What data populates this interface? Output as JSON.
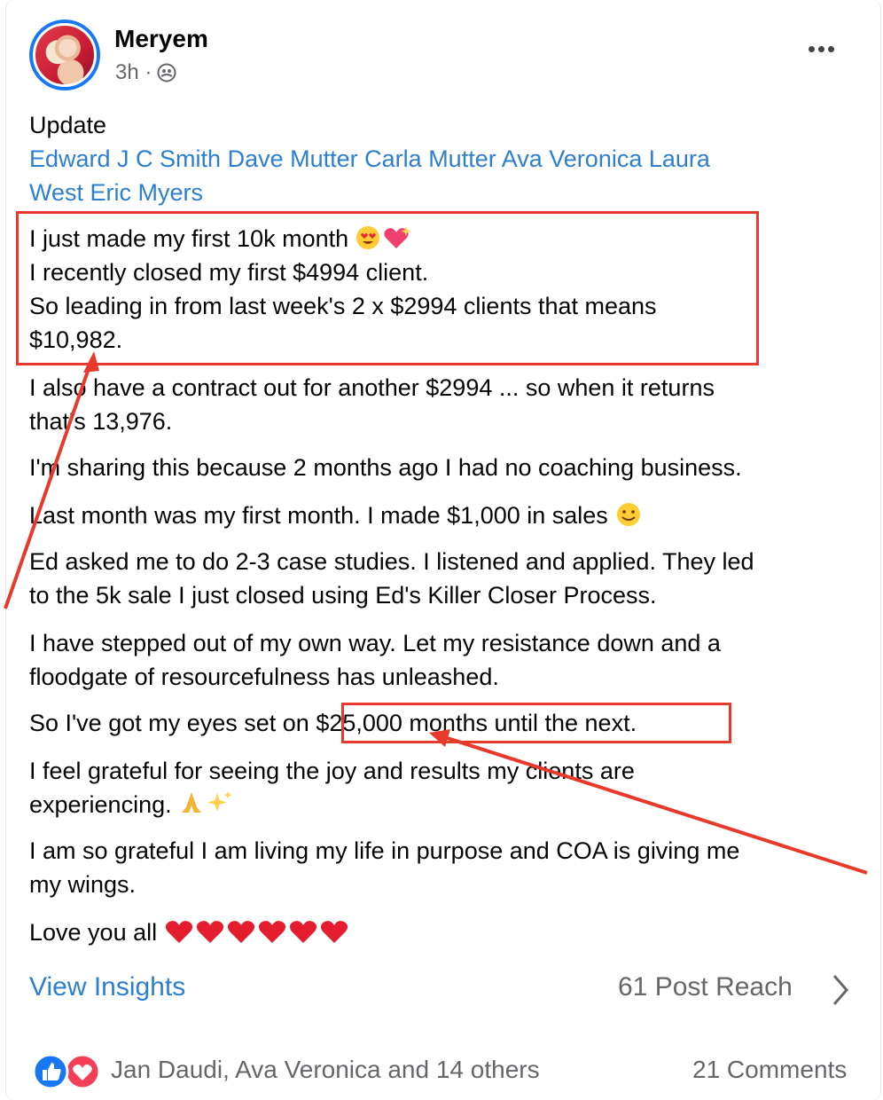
{
  "post": {
    "author": "Meryem",
    "time": "3h ·",
    "privacy_icon": "friends-icon",
    "title": "Update",
    "tags": [
      "Edward J C Smith",
      "Dave Mutter",
      "Carla Mutter",
      "Ava Veronica",
      "Laura",
      "West",
      "Eric Myers"
    ],
    "body": {
      "p1_l1": "I just made my first 10k month",
      "p1_l2": "I recently closed my first $4994 client.",
      "p1_l3": "So leading in from last week's 2  x $2994 clients that means",
      "p1_l4": "$10,982.",
      "p2_l1": "I also have a contract out for another $2994 ... so when it returns",
      "p2_l2": "that's 13,976.",
      "p3": "I'm sharing this because 2 months ago I had no coaching business.",
      "p4": "Last month was my first month. I made $1,000 in sales",
      "p5_l1": "Ed asked me to do 2-3 case studies. I listened and applied. They led",
      "p5_l2": "to the 5k sale I just closed using Ed's Killer Closer Process.",
      "p6_l1": "I have stepped out of my own way. Let my resistance down and a",
      "p6_l2": "floodgate of resourcefulness has unleashed.",
      "p7_a": "So I've got my eyes set on ",
      "p7_b": "$25,000 months until the next.",
      "p8_l1": "I feel grateful for seeing the joy and results my clients are",
      "p8_l2": "experiencing.",
      "p9_l1": "I am so grateful I am living my life in purpose and COA is giving me",
      "p9_l2": "my wings.",
      "p10": "Love you all"
    }
  },
  "footer": {
    "insights": "View Insights",
    "reach": "61 Post Reach",
    "reaction_names": "Jan Daudi, Ava Veronica and 14 others",
    "comments": "21 Comments"
  },
  "colors": {
    "link": "#2d7fcf",
    "annotation": "#e8392b",
    "secondary_text": "#65676b",
    "like_blue": "#1877f2",
    "love_red": "#f33e58"
  }
}
